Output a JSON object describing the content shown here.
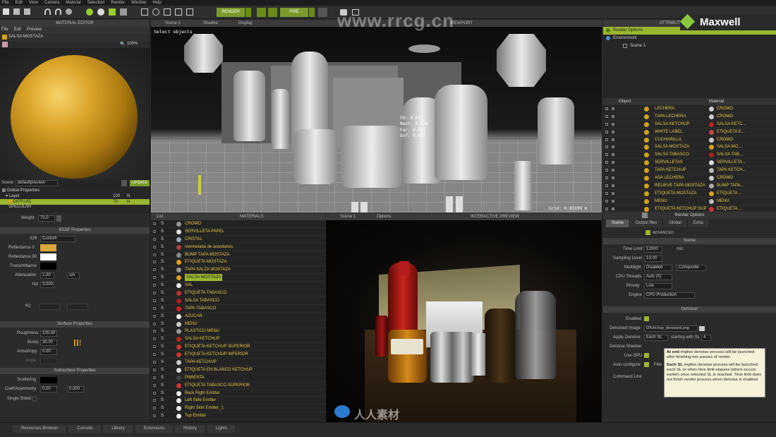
{
  "menu": [
    "File",
    "Edit",
    "View",
    "Camera",
    "Material",
    "Selection",
    "Render",
    "Window",
    "Help"
  ],
  "toolbar": {
    "render_label": "RENDER",
    "fire_label": "FIRE"
  },
  "brand": "Maxwell",
  "watermark": "www.rrcg.cn",
  "material_editor": {
    "title": "MATERIAL EDITOR",
    "menu": [
      "File",
      "Edit",
      "Preview"
    ],
    "material_name": "SALSA MOSTAZA",
    "zoom": "100%",
    "scene_label": "Scene",
    "scene_value": "defaultpreview",
    "update_label": "UPDATE",
    "tree": [
      "Global Properties",
      "Layer",
      "DIFFUSE",
      "SPECULAR"
    ],
    "tree_vals": [
      [
        "100",
        "N"
      ],
      [
        "70",
        "N"
      ]
    ],
    "weight_label": "Weight",
    "weight_value": "70.0",
    "bsdf": {
      "title": "BSDF Properties",
      "ior_label": "IOR",
      "ior_value": "Custom",
      "refl0": "Reflectance 0",
      "refl90": "Reflectance 90",
      "transmittance": "Transmittance",
      "attenuation": "Attenuation",
      "att_value": "1.00",
      "att_unit": "um",
      "nd_label": "Nd",
      "nd_value": "3.000",
      "r2_label": "R2"
    },
    "surface": {
      "title": "Surface Properties",
      "roughness": "Roughness",
      "roughness_value": "100.00",
      "bump": "Bump",
      "bump_value": "30.00",
      "anisotropy": "Anisotropy",
      "anisotropy_value": "0.00",
      "angle_label": "Angle"
    },
    "subsurface": {
      "title": "Subsurface Properties",
      "scattering": "Scattering",
      "coef": "Coef/Asymmetry",
      "coef_value": "0.00",
      "coef_value2": "0.000",
      "single": "Single Sided"
    }
  },
  "viewport": {
    "title": "VIEWPORT",
    "scene": "Scene 1",
    "shading": "Shaded",
    "display": "Display",
    "select_hint": "Select objects",
    "info": [
      "FD: 0.541",
      "Near: 0.534",
      "Far: 0.591",
      "Dof: 0.057"
    ],
    "grid": "Grid: 0.03199 m"
  },
  "attributes": {
    "title": "ATTRIBUTES",
    "render_options": "Render Options",
    "environment": "Environment",
    "scene1": "Scene 1",
    "col_object": "Object",
    "col_material": "Material",
    "objects": [
      [
        "LECHERA",
        "CROMO"
      ],
      [
        "TAPA LECHERA",
        "CROMO"
      ],
      [
        "SALSA KETCHUP",
        "SALSA KETC..."
      ],
      [
        "WHITE LABEL",
        "ETIQUETA E..."
      ],
      [
        "CUCHARILLA",
        "CROMO"
      ],
      [
        "SALSA MOSTAZA",
        "SALSA MO..."
      ],
      [
        "SALSA TABASCO",
        "SALSA TAB..."
      ],
      [
        "SERVILLETAS",
        "SERVILLETA..."
      ],
      [
        "TAPA KETCHUP",
        "TAPA KETCH..."
      ],
      [
        "ASA LECHERA",
        "CROMO"
      ],
      [
        "RELIEVE TAPA MOSTAZA",
        "BUMP TAPA..."
      ],
      [
        "ETIQUETA MOSTAZA",
        "ETIQUETA ..."
      ],
      [
        "MENU",
        "MENU"
      ],
      [
        "ETIQUETA KETCHUP SUP",
        "ETIQUETA ..."
      ]
    ],
    "obj_colors": [
      "#d4a017",
      "#d4a017",
      "#d4a017",
      "#d4a017",
      "#d4a017",
      "#d4a017",
      "#d4a017",
      "#d4a017",
      "#d4a017",
      "#d4a017",
      "#d4a017",
      "#d4a017",
      "#d4a017",
      "#d4a017"
    ],
    "mat_colors": [
      "#ccc",
      "#ccc",
      "#b22",
      "#c44",
      "#ccc",
      "#d9a020",
      "#a22",
      "#ddd",
      "#bbb",
      "#ccc",
      "#aaa",
      "#d9a020",
      "#bbb",
      "#c33"
    ]
  },
  "render_options": {
    "title": "Render Options",
    "tabs": [
      "Scene",
      "Output files",
      "Global",
      "Extra"
    ],
    "advanced": "ADVANCED",
    "scene_section": "Scene",
    "time_limit": "Time Limit",
    "time_value": "12000",
    "time_unit": "min",
    "sampling": "Sampling Level",
    "sampling_value": "13.00",
    "multilight": "Multilight",
    "multilight_value": "Disabled",
    "multilight_mode": "Composite",
    "cpu": "CPU Threads",
    "cpu_value": "Auto (0)",
    "priority": "Priority",
    "priority_value": "Low",
    "engine": "Engine",
    "engine_value": "CPU Production",
    "denoiser_section": "Denoiser",
    "enabled": "Enabled",
    "denoised_image": "Denoised Image",
    "denoised_value": "t2Ketchup_denoised.png",
    "apply_denoise": "Apply Denoise",
    "apply_value": "Each SL",
    "starting_label": "starting with SL",
    "starting_value": "4",
    "denoise_shadow": "Denoise Shadow",
    "use_gpu": "Use GPU",
    "auto_configure": "Auto configure",
    "filter_label": "Filte",
    "command_line": "Command Line",
    "tooltip_b1": "At end",
    "tooltip_t1": " implies denoise process will be launched after finishing two passes of render.",
    "tooltip_b2": "Each SL",
    "tooltip_t2": " implies denoise process will be launched each SL or when time limit elapses (which occurs earlier) once selected SL is reached. Time limit does not finish render process when denoise is enabled."
  },
  "materials": {
    "title": "MATERIALS",
    "list_label": "List",
    "items": [
      "CROMO",
      "SERVILLETA PAPEL",
      "CRISTAL",
      "mermelada de arandanos",
      "BUMP TAPA MOSTAZA",
      "ETIQUETA MOSTAZA",
      "TAPA SALZA MOSTAZA",
      "SALSA MOSTAZA",
      "SAL",
      "ETIQUETA TABASCO",
      "SALSA TABASCO",
      "TAPA TABASCO",
      "AZUCAR",
      "MENU",
      "PLASTICO MENU",
      "SALSA KETCHUP",
      "ETIQUETA KETCHUP SUPERIOR",
      "ETIQUETA KETCHUP INFERIOR",
      "TAPA KETCHUP",
      "ETIQUETA EN BLANCO KETCHUP",
      "PIMIENTA",
      "ETIQUETA TABASCO SUPERIOR",
      "Back Right Emitter",
      "Left Side Emitter",
      "Right Side Emitter_1",
      "Top Emitter"
    ],
    "colors": [
      "#999",
      "#ddd",
      "#9ab",
      "#a44",
      "#888",
      "#d9a020",
      "#999",
      "#d9a020",
      "#eee",
      "#b33",
      "#a22",
      "#c22",
      "#eee",
      "#ccc",
      "#999",
      "#b22",
      "#c33",
      "#c33",
      "#ccc",
      "#ddd",
      "#444",
      "#c33",
      "#eee",
      "#eee",
      "#eee",
      "#eee"
    ]
  },
  "preview": {
    "title": "INTERACTIVE PREVIEW",
    "scene": "Scene 1",
    "options": "Options"
  },
  "bottom_tabs": [
    "Resources Browser",
    "Console",
    "Library",
    "Extensions",
    "History",
    "Lights"
  ],
  "footer_logo": "人人素材"
}
